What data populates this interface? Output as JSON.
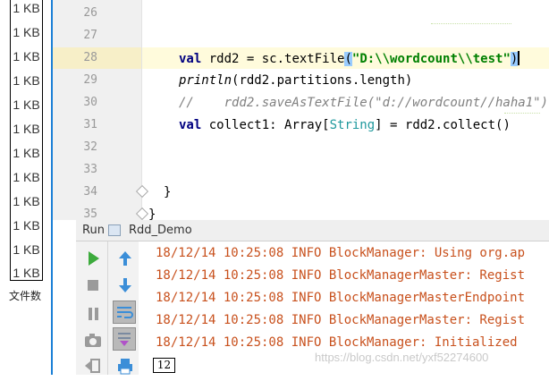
{
  "file_sizes": {
    "items": [
      "1 KB",
      "1 KB",
      "1 KB",
      "1 KB",
      "1 KB",
      "1 KB",
      "1 KB",
      "1 KB",
      "1 KB",
      "1 KB",
      "1 KB",
      "1 KB"
    ],
    "caption": "文件数"
  },
  "editor": {
    "line_numbers": [
      "26",
      "27",
      "28",
      "29",
      "30",
      "31",
      "32",
      "33",
      "34",
      "35"
    ],
    "lines": {
      "l28": {
        "kw": "val",
        "a": " rdd2 = sc.textFile",
        "p1": "(",
        "str": "\"D:\\\\wordcount\\\\test\"",
        "p2": ")"
      },
      "l29": {
        "fn": "println",
        "rest": "(rdd2.partitions.length)"
      },
      "l30": {
        "comment": "//    rdd2.saveAsTextFile(\"d://wordcount//haha1\")"
      },
      "l31": {
        "kw": "val",
        "a": " collect1: Array[",
        "type": "String",
        "b": "] = rdd2.collect()"
      },
      "l34": {
        "text": "}"
      },
      "l35": {
        "text": "}"
      }
    }
  },
  "run_panel": {
    "label": "Run",
    "tab_label": "Rdd_Demo",
    "log_lines": [
      "18/12/14 10:25:08 INFO BlockManager: Using org.ap",
      "18/12/14 10:25:08 INFO BlockManagerMaster: Regist",
      "18/12/14 10:25:08 INFO BlockManagerMasterEndpoint",
      "18/12/14 10:25:08 INFO BlockManagerMaster: Regist",
      "18/12/14 10:25:08 INFO BlockManager: Initialized"
    ],
    "input_value": "12",
    "toolbar_icons": [
      "run-icon",
      "stop-icon",
      "pause-icon",
      "camera-icon",
      "exit-icon",
      "up-arrow-icon",
      "down-arrow-icon",
      "soft-wrap-icon",
      "scroll-to-end-icon",
      "print-icon"
    ]
  },
  "watermark": "https://blog.csdn.net/yxf52274600",
  "colors": {
    "accent": "#1a7fd6",
    "log": "#c8501c",
    "keyword": "#000080",
    "string": "#008000"
  }
}
